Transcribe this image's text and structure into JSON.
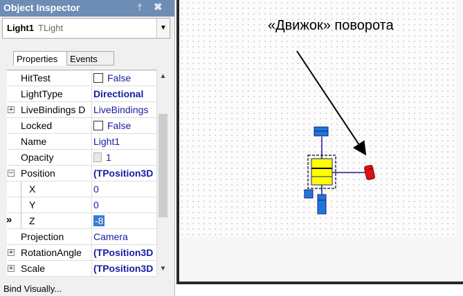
{
  "inspector": {
    "title": "Object Inspector",
    "pin_glyph": "†",
    "close_glyph": "✖",
    "object_name": "Light1",
    "object_class": "TLight",
    "tabs": {
      "properties": "Properties",
      "events": "Events"
    },
    "properties": [
      {
        "name": "HitTest",
        "value": "False",
        "kind": "checkbox"
      },
      {
        "name": "LightType",
        "value": "Directional",
        "kind": "bold"
      },
      {
        "name": "LiveBindings D",
        "value": "LiveBindings",
        "kind": "expand"
      },
      {
        "name": "Locked",
        "value": "False",
        "kind": "checkbox"
      },
      {
        "name": "Name",
        "value": "Light1",
        "kind": "plain"
      },
      {
        "name": "Opacity",
        "value": "1",
        "kind": "spin"
      },
      {
        "name": "Position",
        "value": "(TPosition3D",
        "kind": "collapse-bold"
      },
      {
        "name": "X",
        "value": "0",
        "kind": "sub"
      },
      {
        "name": "Y",
        "value": "0",
        "kind": "sub"
      },
      {
        "name": "Z",
        "value": "-8",
        "kind": "sub-selected",
        "marker": "»"
      },
      {
        "name": "Projection",
        "value": "Camera",
        "kind": "plain"
      },
      {
        "name": "RotationAngle",
        "value": "(TPosition3D",
        "kind": "expand-bold"
      },
      {
        "name": "Scale",
        "value": "(TPosition3D",
        "kind": "expand-bold"
      }
    ],
    "bind_visually": "Bind Visually..."
  },
  "designer": {
    "annotation": "«Движок» поворота"
  },
  "colors": {
    "title_bar": "#6d8db5",
    "value_text": "#1a1aa0",
    "light_body": "#ffff00",
    "light_handles": "#1e78d2",
    "rotation_handle": "#dd1111"
  }
}
